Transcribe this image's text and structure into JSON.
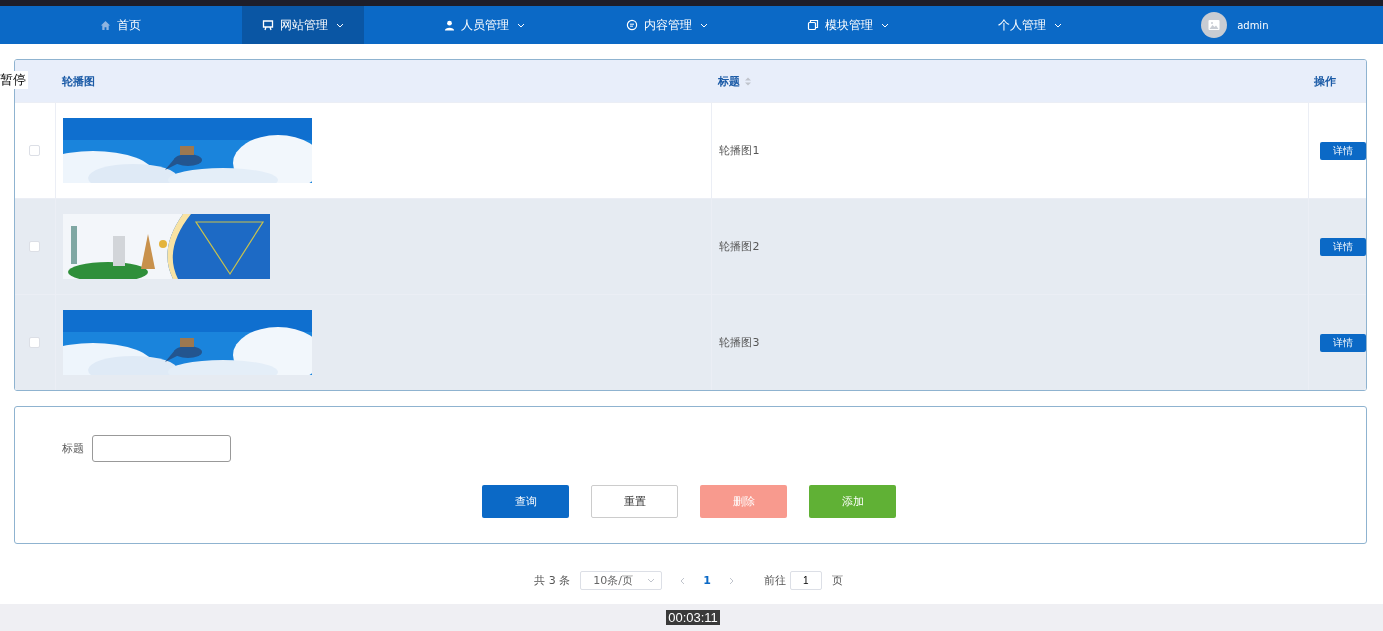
{
  "nav": {
    "items": [
      {
        "label": "首页",
        "selected": false,
        "dropdown": false
      },
      {
        "label": "网站管理",
        "selected": true,
        "dropdown": true
      },
      {
        "label": "人员管理",
        "selected": false,
        "dropdown": true
      },
      {
        "label": "内容管理",
        "selected": false,
        "dropdown": true
      },
      {
        "label": "模块管理",
        "selected": false,
        "dropdown": true
      },
      {
        "label": "个人管理",
        "selected": false,
        "dropdown": true
      }
    ],
    "user": "admin"
  },
  "video_overlay": {
    "status": "暂停",
    "time": "00:03:11"
  },
  "table": {
    "columns": [
      {
        "label": "轮播图",
        "sortable": false
      },
      {
        "label": "标题",
        "sortable": true
      },
      {
        "label": "操作",
        "sortable": false
      }
    ],
    "rows": [
      {
        "checked": false,
        "shaded": false,
        "title": "轮播图1",
        "action": "详情"
      },
      {
        "checked": false,
        "shaded": true,
        "title": "轮播图2",
        "action": "详情"
      },
      {
        "checked": false,
        "shaded": true,
        "title": "轮播图3",
        "action": "详情"
      }
    ]
  },
  "search": {
    "label": "标题",
    "buttons": [
      {
        "label": "查询",
        "kind": "primary"
      },
      {
        "label": "重置",
        "kind": "plain"
      },
      {
        "label": "删除",
        "kind": "danger"
      },
      {
        "label": "添加",
        "kind": "success"
      }
    ]
  },
  "pagination": {
    "total": "共 3 条",
    "page_size": "10条/页",
    "current": "1",
    "goto_label": "前往",
    "goto_value": "1",
    "goto_suffix": "页"
  }
}
